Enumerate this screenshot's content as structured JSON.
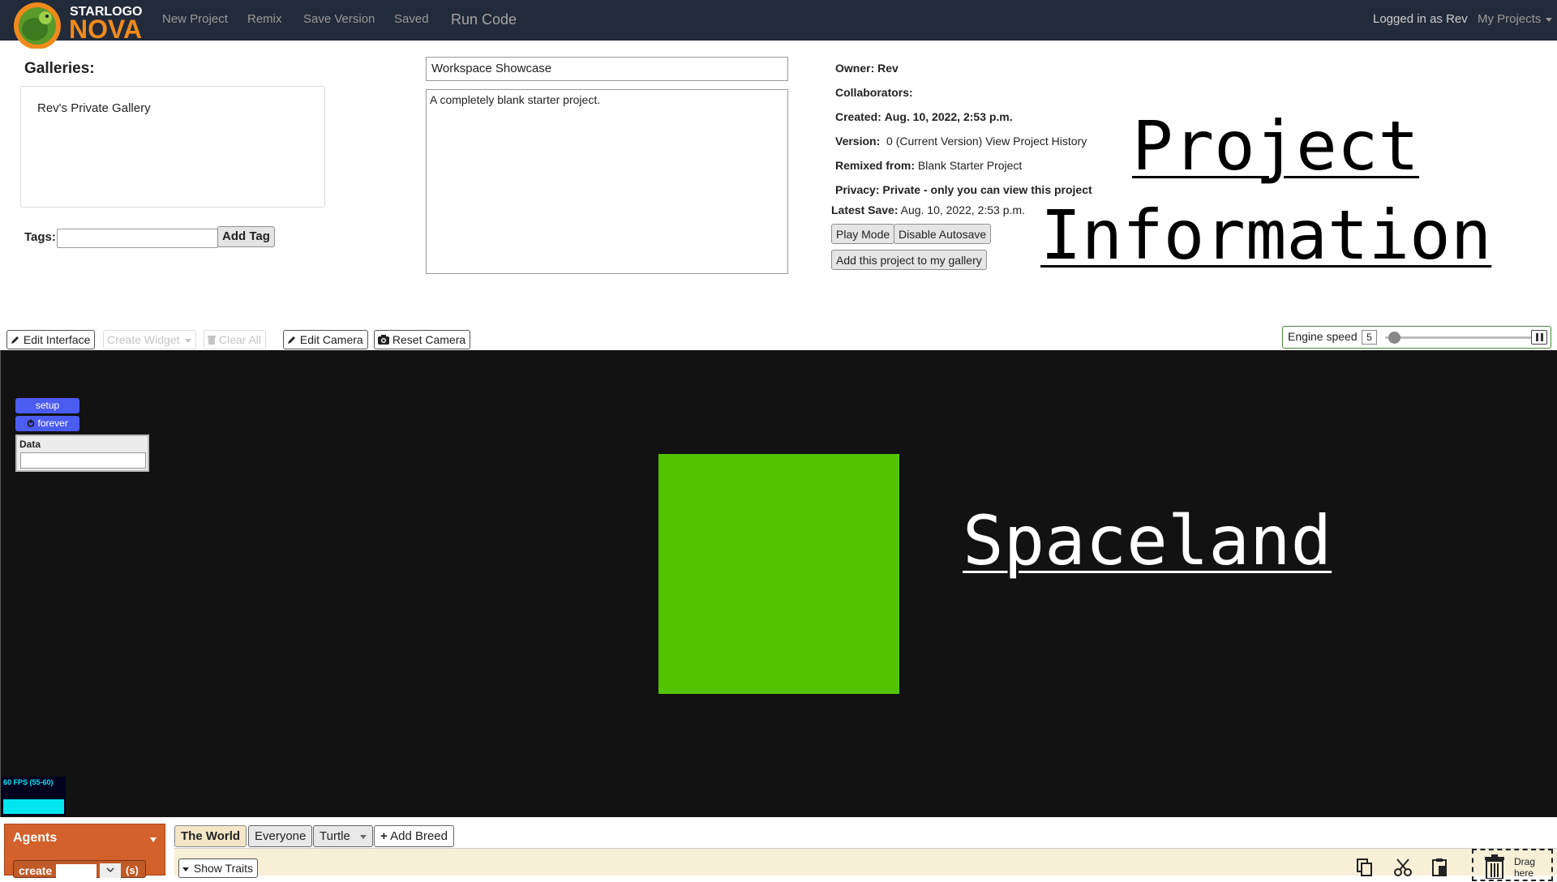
{
  "nav": {
    "logo_top": "STARLOGO",
    "logo_bottom": "NOVA",
    "new_project": "New Project",
    "remix": "Remix",
    "save_version": "Save Version",
    "saved": "Saved",
    "run_code": "Run Code",
    "logged_in": "Logged in as Rev",
    "my_projects": "My Projects"
  },
  "galleries": {
    "title": "Galleries:",
    "items": [
      "Rev's Private Gallery"
    ]
  },
  "tags": {
    "label": "Tags:",
    "input_value": "",
    "add_button": "Add Tag"
  },
  "project": {
    "title": "Workspace Showcase",
    "description": "A completely blank starter project."
  },
  "meta": {
    "owner_label": "Owner:",
    "owner": "Rev",
    "collaborators_label": "Collaborators:",
    "created_label": "Created:",
    "created": "Aug. 10, 2022, 2:53 p.m.",
    "version_label": "Version:",
    "version_value": "0 (Current Version)",
    "view_history": "View Project History",
    "remixed_label": "Remixed from:",
    "remixed_from": "Blank Starter Project",
    "privacy_label": "Privacy:",
    "privacy": "Private - only you can view this project",
    "latest_save_label": "Latest Save:",
    "latest_save": "Aug. 10, 2022, 2:53 p.m.",
    "play_mode": "Play Mode",
    "disable_autosave": "Disable Autosave",
    "add_to_gallery": "Add this project to my gallery"
  },
  "overlay": {
    "project_info_line1": "Project",
    "project_info_line2": "Information",
    "spaceland": "Spaceland"
  },
  "toolbar": {
    "edit_interface": "Edit Interface",
    "create_widget": "Create Widget",
    "clear_all": "Clear All",
    "edit_camera": "Edit Camera",
    "reset_camera": "Reset Camera",
    "engine_speed_label": "Engine speed",
    "engine_speed_value": "5"
  },
  "engine_speed_level": 5,
  "widgets": {
    "setup": "setup",
    "forever": "forever",
    "data_label": "Data",
    "fps": "60 FPS (55-60)"
  },
  "bottom": {
    "agents_label": "Agents",
    "create_label": "create",
    "create_suffix": "(s)",
    "tabs": [
      "The World",
      "Everyone",
      "Turtle"
    ],
    "add_breed": "Add Breed",
    "show_traits": "Show Traits",
    "trash_label_1": "Drag",
    "trash_label_2": "here"
  },
  "colors": {
    "navbar": "#222b3a",
    "spaceland_bg": "#121212",
    "agent_square": "#52c400",
    "widget_button": "#4b5cf0",
    "agents_panel": "#d2612b",
    "workspace_bg": "#f7efd6"
  },
  "icons": {
    "pencil": "pencil-icon",
    "camera": "camera-icon",
    "trash": "trash-icon",
    "copy": "copy-icon",
    "cut": "scissors-icon",
    "paste": "paste-icon",
    "power": "power-icon",
    "plus": "plus-icon",
    "pause": "pause-icon"
  }
}
